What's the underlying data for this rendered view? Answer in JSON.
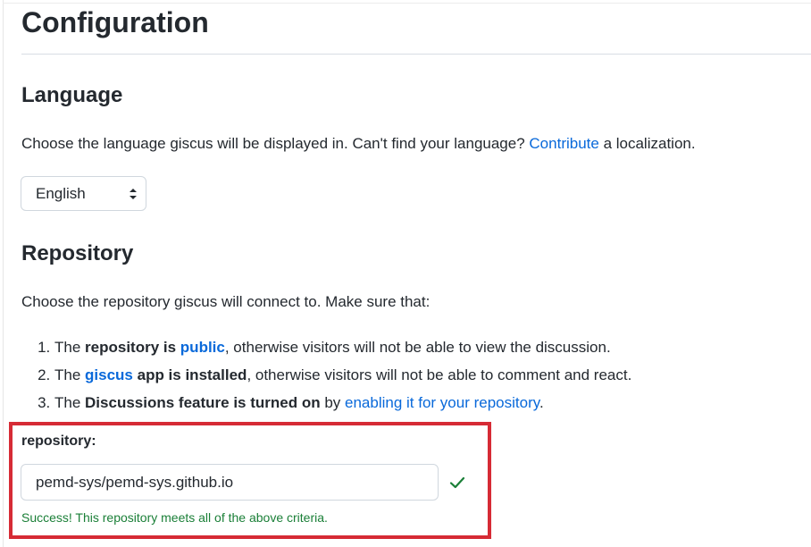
{
  "page": {
    "title": "Configuration"
  },
  "language": {
    "heading": "Language",
    "description_before": "Choose the language giscus will be displayed in. Can't find your language? ",
    "contribute_link": "Contribute",
    "description_after": " a localization.",
    "selected": "English",
    "options": [
      "English"
    ]
  },
  "repository": {
    "heading": "Repository",
    "intro": "Choose the repository giscus will connect to. Make sure that:",
    "items": [
      {
        "before": "The ",
        "bold1": "repository is ",
        "link": "public",
        "after": ", otherwise visitors will not be able to view the discussion."
      },
      {
        "before": "The ",
        "link": "giscus",
        "bold2": " app is installed",
        "after": ", otherwise visitors will not be able to comment and react."
      },
      {
        "before": "The ",
        "bold1": "Discussions feature is turned on",
        "middle": " by ",
        "link": "enabling it for your repository",
        "after": "."
      }
    ],
    "field_label": "repository:",
    "input_value": "pemd-sys/pemd-sys.github.io",
    "success_message": "Success! This repository meets all of the above criteria."
  },
  "colors": {
    "link": "#0969da",
    "success": "#1a7f37",
    "highlight_border": "#d62b35"
  },
  "icons": {
    "select_arrows": "updown-chevrons-icon",
    "valid": "check-icon"
  }
}
